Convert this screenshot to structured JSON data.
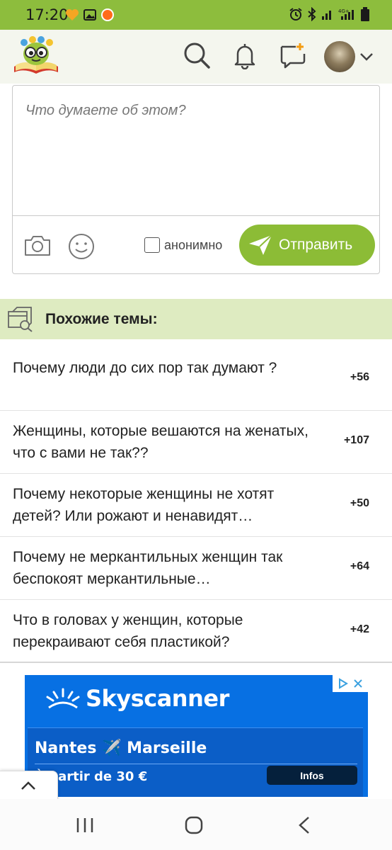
{
  "status_bar": {
    "time": "17:20"
  },
  "header": {
    "icons": [
      "logo-icon",
      "search-icon",
      "bell-icon",
      "new-message-icon",
      "avatar",
      "chevron-down-icon"
    ]
  },
  "comment": {
    "placeholder": "Что думаете об этом?",
    "anonymous_label": "анонимно",
    "send_label": "Отправить"
  },
  "similar": {
    "title": "Похожие темы:",
    "topics": [
      {
        "title": "Почему люди до сих пор так думают ?",
        "score": "+56"
      },
      {
        "title": "Женщины, которые вешаются на женатых, что с вами не так??",
        "score": "+107"
      },
      {
        "title": "Почему некоторые женщины не хотят детей? Или рожают и ненавидят…",
        "score": "+50"
      },
      {
        "title": "Почему не меркантильных женщин так беспокоят меркантильные…",
        "score": "+64"
      },
      {
        "title": "Что в головах у женщин, которые перекраивают себя пластикой?",
        "score": "+42"
      }
    ]
  },
  "ad": {
    "brand": "Skyscanner",
    "route": "Nantes ✈️ Marseille",
    "price": "À partir de 30 €",
    "button": "Infos"
  },
  "colors": {
    "accent": "#8cbc36",
    "header_bg": "#f4f6ee",
    "similar_bg": "#deebc1",
    "ad_bg": "#0770e3"
  }
}
